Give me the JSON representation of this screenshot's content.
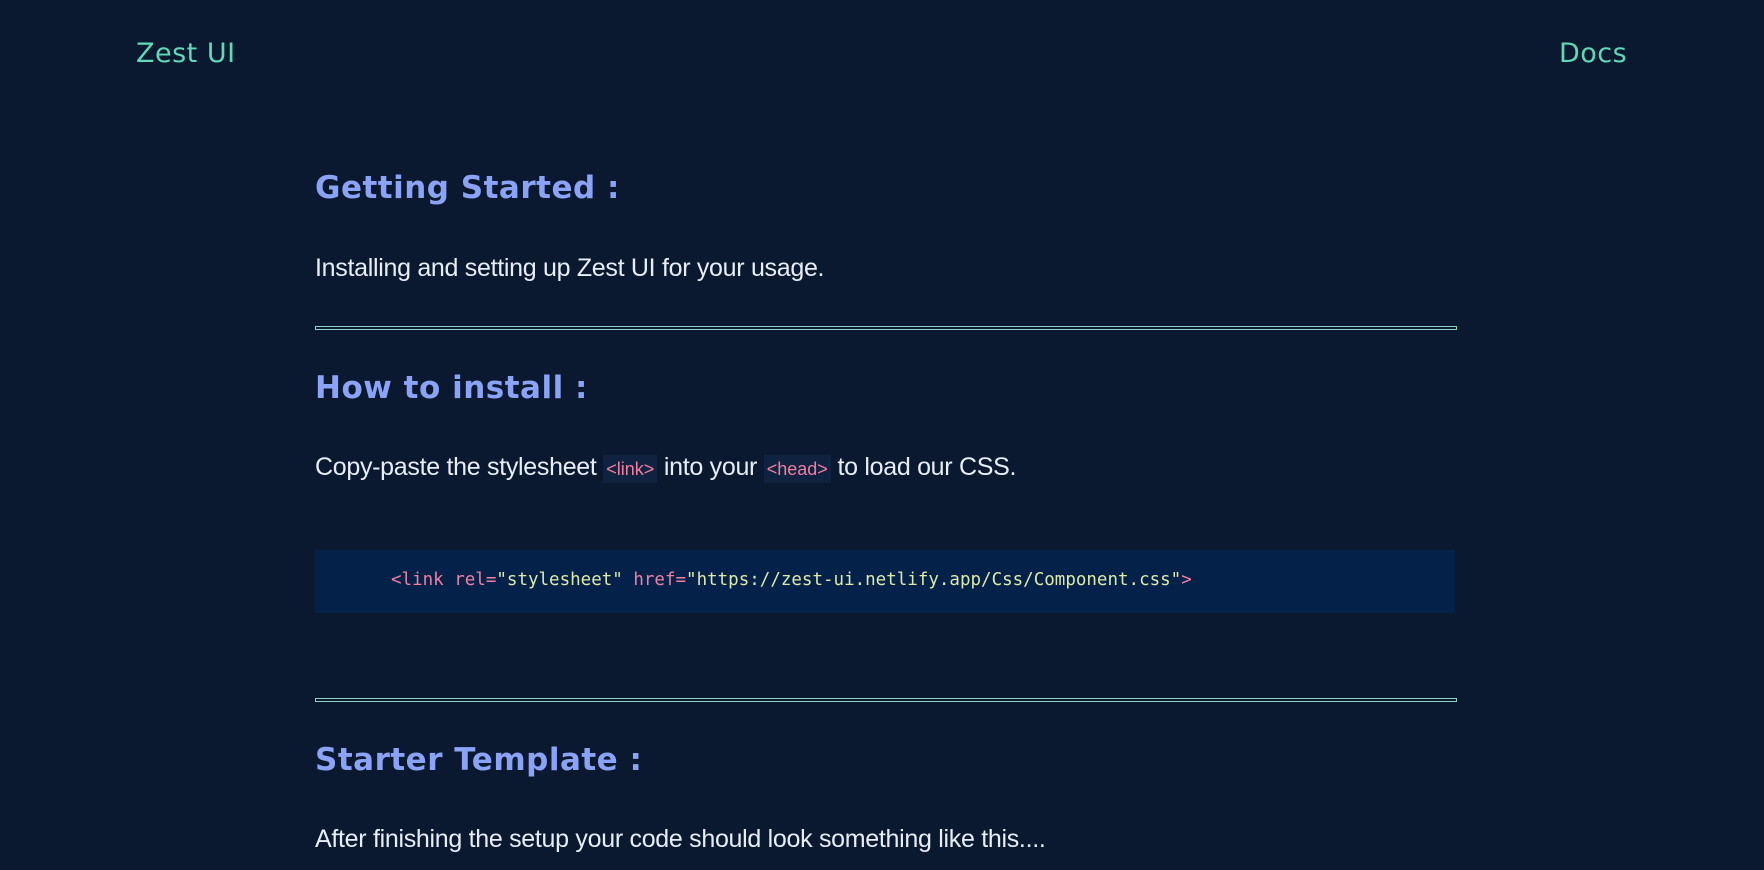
{
  "navbar": {
    "brand": "Zest UI",
    "docs_link": "Docs"
  },
  "sections": [
    {
      "heading": "Getting Started :",
      "text": "Installing and setting up Zest UI for your usage."
    },
    {
      "heading": "How to install :",
      "text_parts": [
        "Copy-paste the stylesheet ",
        "<link>",
        " into your ",
        "<head>",
        " to load our CSS."
      ],
      "code": {
        "open": "<link",
        "attr1": " rel=",
        "val1": "\"stylesheet\"",
        "attr2": " href=",
        "val2": "\"https://zest-ui.netlify.app/Css/Component.css\"",
        "close": ">"
      }
    },
    {
      "heading": "Starter Template :",
      "text": "After finishing the setup your code should look something like this...."
    }
  ],
  "colors": {
    "background": "#0b1930",
    "accent": "#5fd9b8",
    "heading": "#8ba3f7",
    "code_background": "#04214a",
    "code_tag": "#f27fa0",
    "code_string": "#dfe9a8"
  }
}
